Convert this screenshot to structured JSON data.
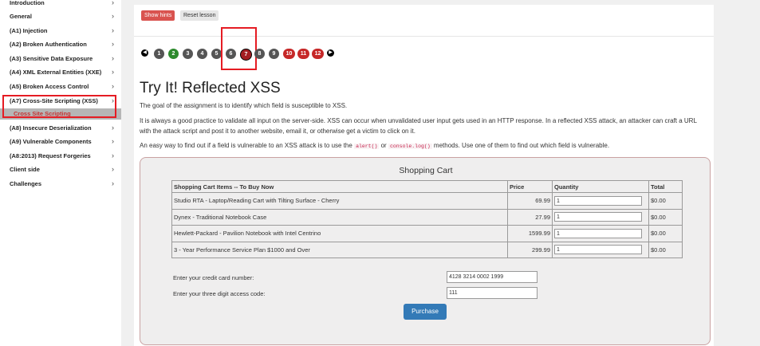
{
  "sidebar": {
    "items": [
      {
        "label": "Introduction"
      },
      {
        "label": "General"
      },
      {
        "label": "(A1) Injection"
      },
      {
        "label": "(A2) Broken Authentication"
      },
      {
        "label": "(A3) Sensitive Data Exposure"
      },
      {
        "label": "(A4) XML External Entities (XXE)"
      },
      {
        "label": "(A5) Broken Access Control"
      },
      {
        "label": "(A7) Cross-Site Scripting (XSS)"
      },
      {
        "label": "(A8) Insecure Deserialization"
      },
      {
        "label": "(A9) Vulnerable Components"
      },
      {
        "label": "(A8:2013) Request Forgeries"
      },
      {
        "label": "Client side"
      },
      {
        "label": "Challenges"
      }
    ],
    "chevron": "›",
    "subitem": "Cross Site Scripting"
  },
  "toolbar": {
    "show_hints": "Show hints",
    "reset_lesson": "Reset lesson"
  },
  "pager": {
    "pages": [
      "1",
      "2",
      "3",
      "4",
      "5",
      "6",
      "7",
      "8",
      "9",
      "10",
      "11",
      "12"
    ],
    "current": "7",
    "prev_icon": "left-arrow-icon",
    "next_icon": "right-arrow-icon"
  },
  "lesson": {
    "title": "Try It! Reflected XSS",
    "p1": "The goal of the assignment is to identify which field is susceptible to XSS.",
    "p2": "It is always a good practice to validate all input on the server-side. XSS can occur when unvalidated user input gets used in an HTTP response. In a reflected XSS attack, an attacker can craft a URL with the attack script and post it to another website, email it, or otherwise get a victim to click on it.",
    "p3_a": "An easy way to find out if a field is vulnerable to an XSS attack is to use the",
    "p3_code1": "alert()",
    "p3_or": "or",
    "p3_code2": "console.log()",
    "p3_b": "methods. Use one of them to find out which field is vulnerable."
  },
  "cart": {
    "title": "Shopping Cart",
    "headers": [
      "Shopping Cart Items -- To Buy Now",
      "Price",
      "Quantity",
      "Total"
    ],
    "rows": [
      {
        "item": "Studio RTA - Laptop/Reading Cart with Tilting Surface - Cherry",
        "price": "69.99",
        "qty": "1",
        "total": "$0.00"
      },
      {
        "item": "Dynex - Traditional Notebook Case",
        "price": "27.99",
        "qty": "1",
        "total": "$0.00"
      },
      {
        "item": "Hewlett-Packard - Pavilion Notebook with Intel Centrino",
        "price": "1599.99",
        "qty": "1",
        "total": "$0.00"
      },
      {
        "item": "3 - Year Performance Service Plan $1000 and Over",
        "price": "299.99",
        "qty": "1",
        "total": "$0.00"
      }
    ],
    "cc_label": "Enter your credit card number:",
    "cc_value": "4128 3214 0002 1999",
    "code_label": "Enter your three digit access code:",
    "code_value": "111",
    "purchase": "Purchase"
  },
  "colors": {
    "accent_red": "#e51c23",
    "page_red": "#a41e22",
    "green": "#2c8a2c",
    "dark": "#555555",
    "primary": "#337ab7"
  }
}
